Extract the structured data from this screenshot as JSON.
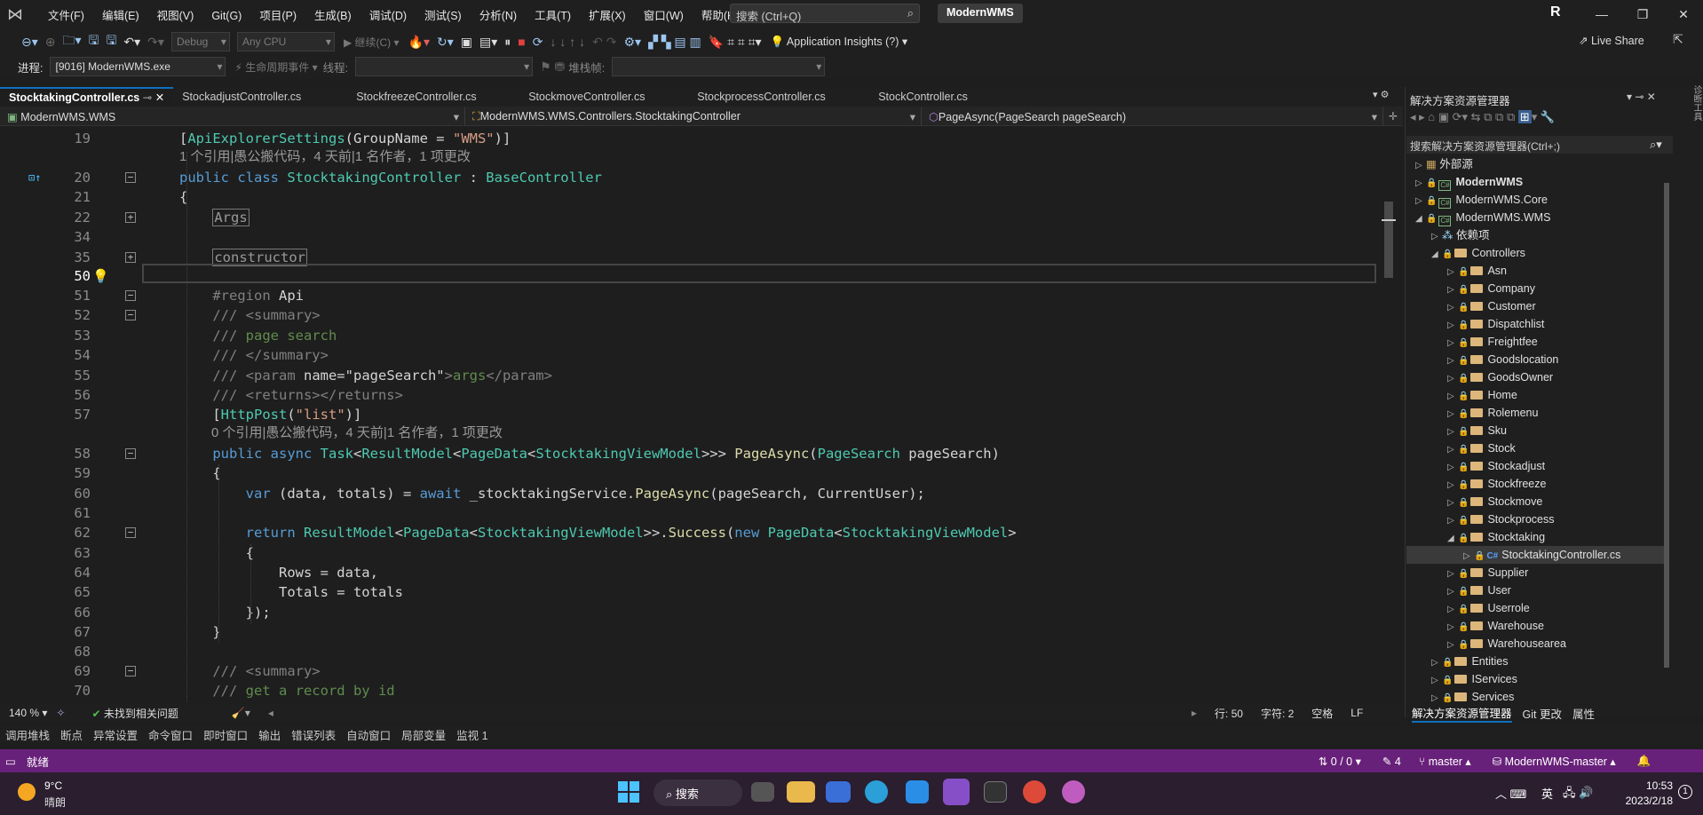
{
  "titlebar": {
    "menu": [
      "文件(F)",
      "编辑(E)",
      "视图(V)",
      "Git(G)",
      "项目(P)",
      "生成(B)",
      "调试(D)",
      "测试(S)",
      "分析(N)",
      "工具(T)",
      "扩展(X)",
      "窗口(W)",
      "帮助(H)"
    ],
    "search_placeholder": "搜索 (Ctrl+Q)",
    "solution_name": "ModernWMS",
    "avatar": "R"
  },
  "toolbar": {
    "config": "Debug",
    "platform": "Any CPU",
    "continue_label": "继续(C)",
    "app_insights": "Application Insights (?)",
    "live_share": "Live Share"
  },
  "toolbar2": {
    "process_label": "进程:",
    "process_value": "[9016] ModernWMS.exe",
    "lifecycle_label": "生命周期事件",
    "thread_label": "线程:",
    "stack_label": "堆栈帧:"
  },
  "tabs": [
    {
      "label": "StocktakingController.cs",
      "active": true
    },
    {
      "label": "StockadjustController.cs"
    },
    {
      "label": "StockfreezeController.cs"
    },
    {
      "label": "StockmoveController.cs"
    },
    {
      "label": "StockprocessController.cs"
    },
    {
      "label": "StockController.cs"
    }
  ],
  "navbar": {
    "project": "ModernWMS.WMS",
    "class": "ModernWMS.WMS.Controllers.StocktakingController",
    "member": "PageAsync(PageSearch pageSearch)"
  },
  "editor": {
    "lens1": "1 个引用|愚公搬代码，4 天前|1 名作者，1 项更改",
    "lens2": "0 个引用|愚公搬代码，4 天前|1 名作者，1 项更改",
    "line_numbers": [
      "19",
      "20",
      "21",
      "22",
      "34",
      "35",
      "50",
      "51",
      "52",
      "53",
      "54",
      "55",
      "56",
      "57",
      "58",
      "59",
      "60",
      "61",
      "62",
      "63",
      "64",
      "65",
      "66",
      "67",
      "68",
      "69",
      "70"
    ],
    "current_line": "50"
  },
  "editor_status": {
    "zoom": "140 %",
    "issues": "未找到相关问题",
    "line": "行: 50",
    "char": "字符: 2",
    "ws": "空格",
    "eol": "LF"
  },
  "panel_tabs": [
    "调用堆栈",
    "断点",
    "异常设置",
    "命令窗口",
    "即时窗口",
    "输出",
    "错误列表",
    "自动窗口",
    "局部变量",
    "监视 1"
  ],
  "statusbar": {
    "ready": "就绪",
    "arrows": "0 / 0",
    "pencil": "4",
    "branch": "master",
    "repo": "ModernWMS-master"
  },
  "solution_explorer": {
    "title": "解决方案资源管理器",
    "search_placeholder": "搜索解决方案资源管理器(Ctrl+;)",
    "items": [
      {
        "label": "外部源",
        "level": 0,
        "type": "ext"
      },
      {
        "label": "ModernWMS",
        "level": 0,
        "type": "proj",
        "bold": true
      },
      {
        "label": "ModernWMS.Core",
        "level": 0,
        "type": "proj"
      },
      {
        "label": "ModernWMS.WMS",
        "level": 0,
        "type": "proj",
        "expanded": true
      },
      {
        "label": "依赖项",
        "level": 1,
        "type": "dep"
      },
      {
        "label": "Controllers",
        "level": 1,
        "type": "folder",
        "expanded": true
      },
      {
        "label": "Asn",
        "level": 2,
        "type": "folder"
      },
      {
        "label": "Company",
        "level": 2,
        "type": "folder"
      },
      {
        "label": "Customer",
        "level": 2,
        "type": "folder"
      },
      {
        "label": "Dispatchlist",
        "level": 2,
        "type": "folder"
      },
      {
        "label": "Freightfee",
        "level": 2,
        "type": "folder"
      },
      {
        "label": "Goodslocation",
        "level": 2,
        "type": "folder"
      },
      {
        "label": "GoodsOwner",
        "level": 2,
        "type": "folder"
      },
      {
        "label": "Home",
        "level": 2,
        "type": "folder"
      },
      {
        "label": "Rolemenu",
        "level": 2,
        "type": "folder"
      },
      {
        "label": "Sku",
        "level": 2,
        "type": "folder"
      },
      {
        "label": "Stock",
        "level": 2,
        "type": "folder"
      },
      {
        "label": "Stockadjust",
        "level": 2,
        "type": "folder"
      },
      {
        "label": "Stockfreeze",
        "level": 2,
        "type": "folder"
      },
      {
        "label": "Stockmove",
        "level": 2,
        "type": "folder"
      },
      {
        "label": "Stockprocess",
        "level": 2,
        "type": "folder"
      },
      {
        "label": "Stocktaking",
        "level": 2,
        "type": "folder",
        "expanded": true
      },
      {
        "label": "StocktakingController.cs",
        "level": 3,
        "type": "cs",
        "selected": true
      },
      {
        "label": "Supplier",
        "level": 2,
        "type": "folder"
      },
      {
        "label": "User",
        "level": 2,
        "type": "folder"
      },
      {
        "label": "Userrole",
        "level": 2,
        "type": "folder"
      },
      {
        "label": "Warehouse",
        "level": 2,
        "type": "folder"
      },
      {
        "label": "Warehousearea",
        "level": 2,
        "type": "folder"
      },
      {
        "label": "Entities",
        "level": 1,
        "type": "folder"
      },
      {
        "label": "IServices",
        "level": 1,
        "type": "folder"
      },
      {
        "label": "Services",
        "level": 1,
        "type": "folder"
      }
    ],
    "bottom_tabs": [
      "解决方案资源管理器",
      "Git 更改",
      "属性"
    ]
  },
  "taskbar": {
    "weather_temp": "9°C",
    "weather_desc": "晴朗",
    "search_label": "搜索",
    "ime": "英",
    "time": "10:53",
    "date": "2023/2/18",
    "notif": "1"
  },
  "colors": {
    "accent": "#68217a",
    "tab_active_border": "#0e70c0"
  }
}
